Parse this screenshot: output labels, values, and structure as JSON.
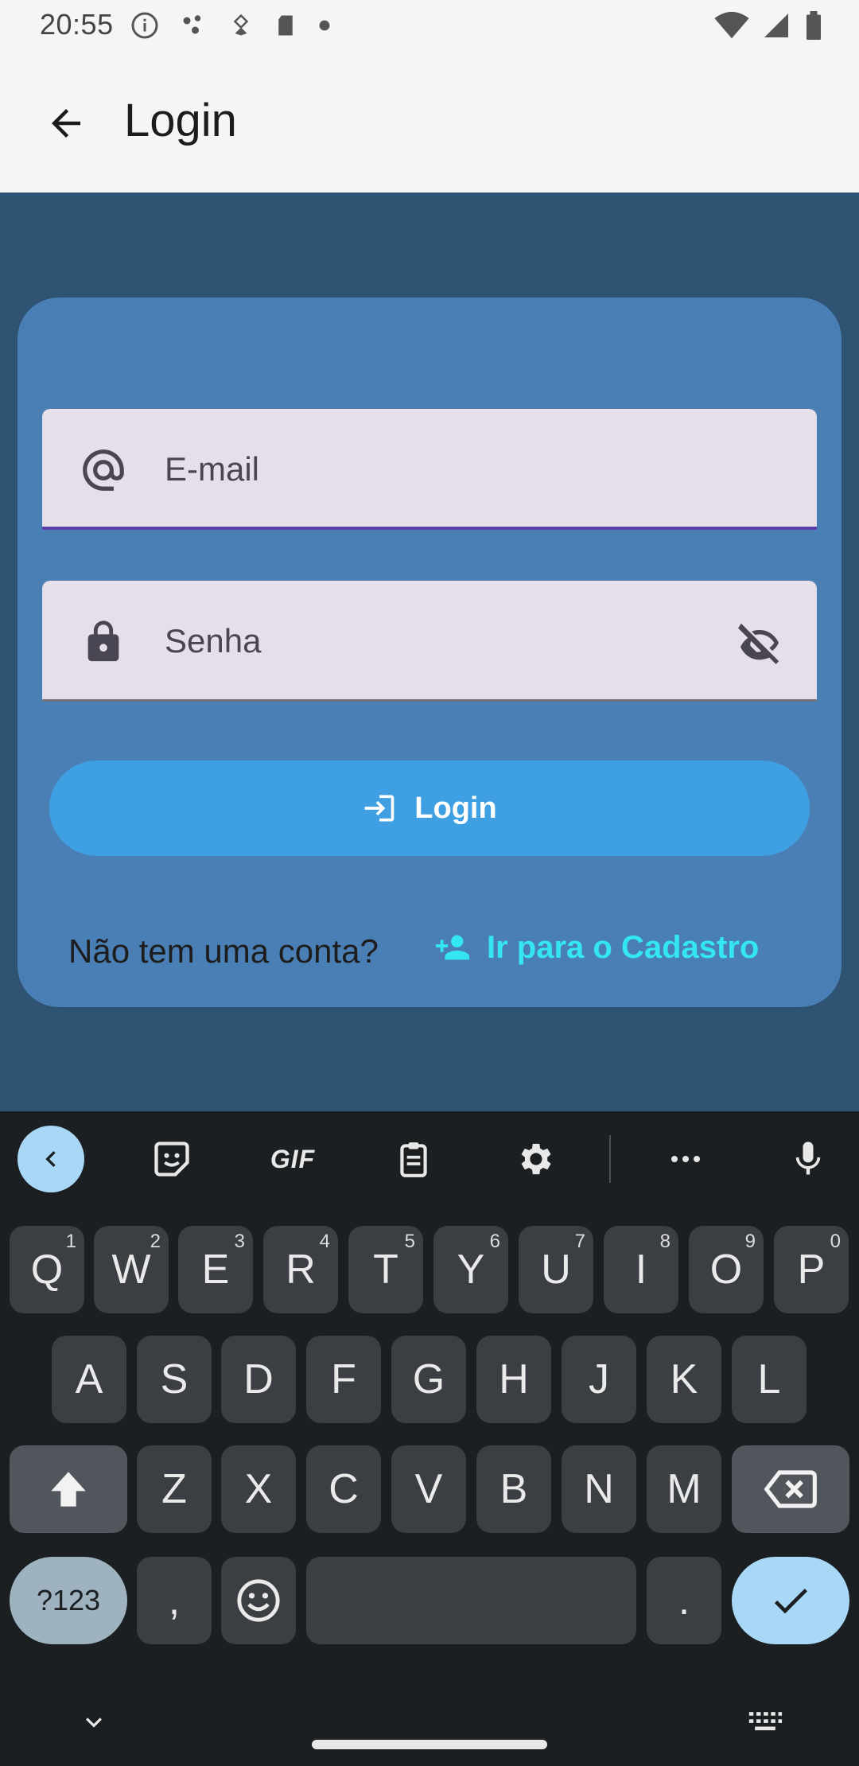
{
  "status_bar": {
    "time": "20:55",
    "icons_left": [
      "info-icon",
      "dots-icon",
      "usb-debug-icon",
      "sd-card-icon",
      "dot-icon"
    ],
    "icons_right": [
      "wifi-icon",
      "signal-icon",
      "battery-icon"
    ]
  },
  "app_bar": {
    "title": "Login",
    "back_icon": "arrow-back-icon"
  },
  "form": {
    "email_label": "E-mail",
    "email_icon": "at-icon",
    "password_label": "Senha",
    "password_icon": "lock-icon",
    "password_toggle_icon": "visibility-off-icon",
    "login_label": "Login",
    "login_icon": "login-icon",
    "no_account_text": "Não tem uma conta?",
    "signup_label": "Ir para o Cadastro",
    "signup_icon": "person-add-icon"
  },
  "keyboard": {
    "toolbar": [
      "collapse-icon",
      "sticker-icon",
      "GIF",
      "clipboard-icon",
      "settings-icon",
      "more-icon",
      "mic-icon"
    ],
    "row1": [
      {
        "k": "Q",
        "h": "1"
      },
      {
        "k": "W",
        "h": "2"
      },
      {
        "k": "E",
        "h": "3"
      },
      {
        "k": "R",
        "h": "4"
      },
      {
        "k": "T",
        "h": "5"
      },
      {
        "k": "Y",
        "h": "6"
      },
      {
        "k": "U",
        "h": "7"
      },
      {
        "k": "I",
        "h": "8"
      },
      {
        "k": "O",
        "h": "9"
      },
      {
        "k": "P",
        "h": "0"
      }
    ],
    "row2": [
      "A",
      "S",
      "D",
      "F",
      "G",
      "H",
      "J",
      "K",
      "L"
    ],
    "row3": [
      "Z",
      "X",
      "C",
      "V",
      "B",
      "N",
      "M"
    ],
    "symbols_label": "?123",
    "comma": ",",
    "period": ".",
    "gif_label": "GIF",
    "colors": {
      "background": "#1b1f22",
      "key": "#3b3f43",
      "accent": "#a8d8f6"
    }
  },
  "colors": {
    "page_bg": "#2f5373",
    "card_bg": "#4a7fb5",
    "field_bg": "#e6dfe9",
    "button_bg": "#3ea0e2",
    "link": "#33e6f0"
  }
}
